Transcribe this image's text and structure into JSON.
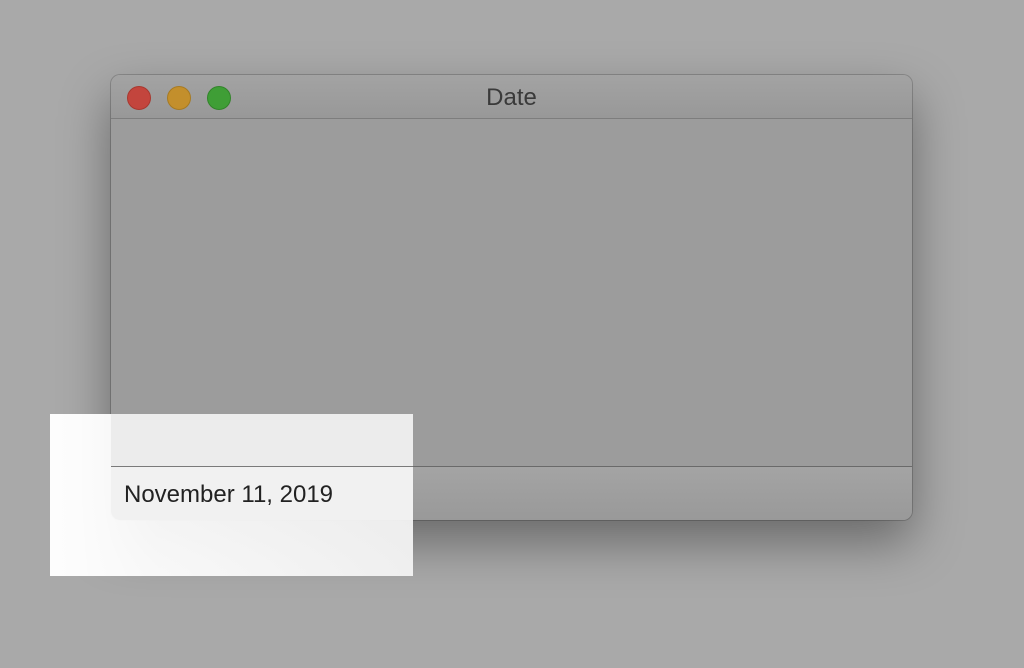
{
  "window": {
    "title": "Date",
    "controls": {
      "close": "close-icon",
      "minimize": "minimize-icon",
      "zoom": "zoom-icon"
    }
  },
  "status": {
    "date_text": "November 11, 2019"
  },
  "colors": {
    "desktop": "#a9a9a9",
    "close": "#c3453d",
    "minimize": "#c38f2c",
    "zoom": "#3f9e36"
  }
}
